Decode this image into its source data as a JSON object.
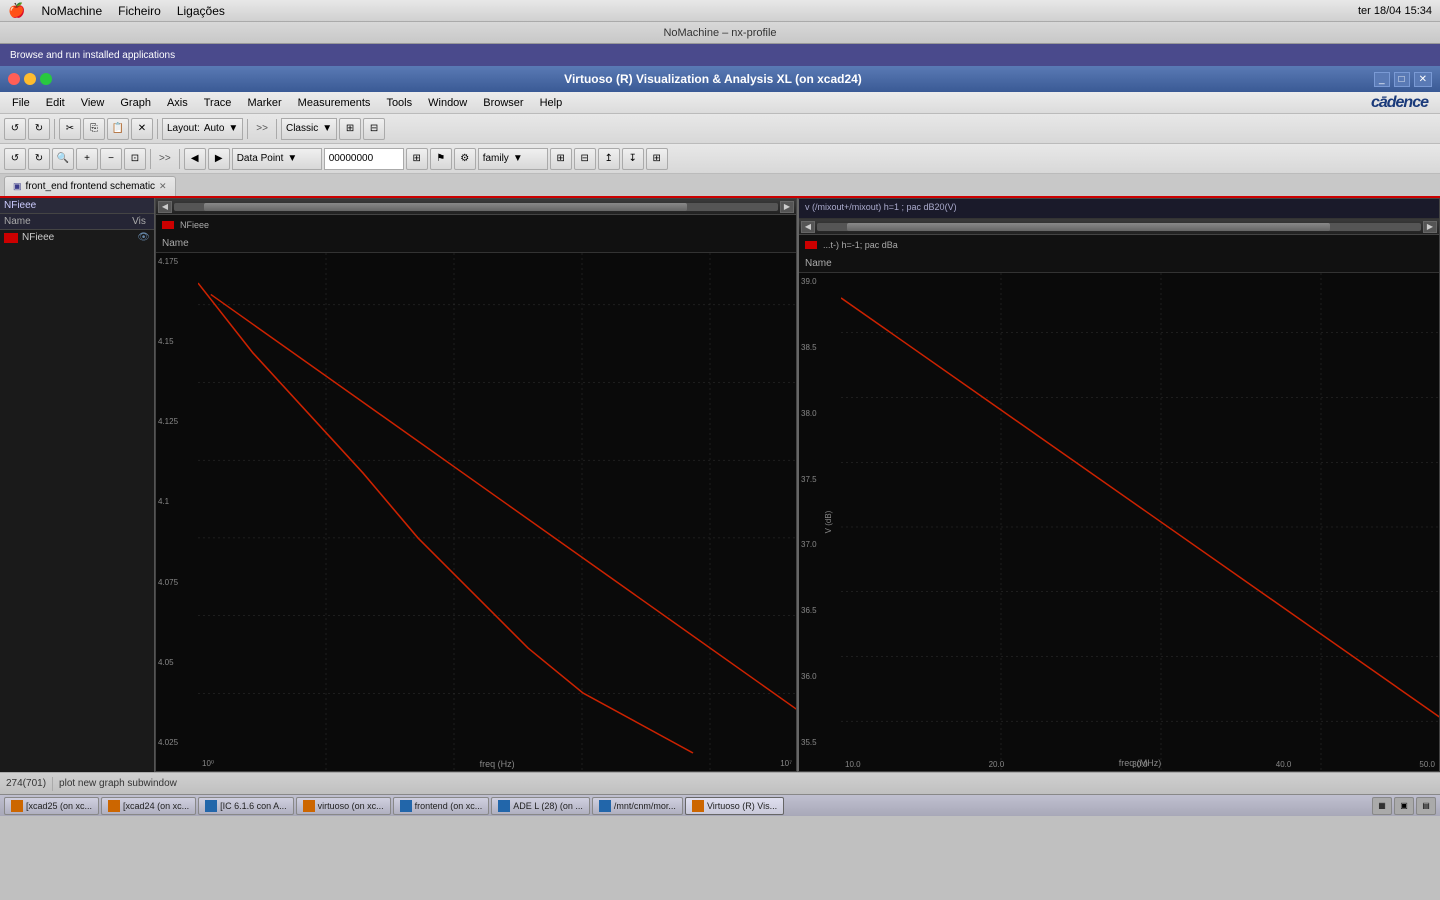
{
  "mac": {
    "apple": "🍎",
    "menus": [
      "NoMachine",
      "Ficheiro",
      "Ligações"
    ],
    "right_items": [
      "3:34 PM"
    ],
    "title": "NoMachine – nx-profile"
  },
  "browse_bar": {
    "text": "Browse and run installed applications"
  },
  "virt_title": "Virtuoso (R) Visualization & Analysis XL (on xcad24)",
  "menu_bar": {
    "items": [
      "File",
      "Edit",
      "View",
      "Graph",
      "Axis",
      "Trace",
      "Marker",
      "Measurements",
      "Tools",
      "Window",
      "Browser",
      "Help"
    ],
    "cadence": "cādence"
  },
  "toolbar1": {
    "layout_label": "Layout:",
    "layout_value": "Auto",
    "classic_value": "Classic",
    "expand": ">>"
  },
  "toolbar2": {
    "data_point": "Data Point",
    "value": "00000000",
    "family": "family",
    "expand": ">>"
  },
  "tab": {
    "label": "front_end frontend schematic",
    "close": "✕",
    "icon": "▣"
  },
  "graph1": {
    "header": "",
    "legend_label": "Name",
    "legend_item": "NFieee",
    "scrollbar_thumb_left": "5%",
    "scrollbar_thumb_width": "80%",
    "trace_label": "NFieee",
    "y_values": [
      "4.175",
      "4.15",
      "4.125",
      "4.1",
      "4.075",
      "4.05",
      "4.025"
    ],
    "x_label": "freq (Hz)",
    "x_min": "10⁰",
    "x_max": "10⁷",
    "panel_title": "NFieee"
  },
  "graph2": {
    "header": "v (/mixout+/mixout) h=1 ; pac dB20(V)",
    "legend_label": "Name",
    "legend_item": "...t-) h=-1; pac dBa",
    "scrollbar_thumb_left": "5%",
    "scrollbar_thumb_width": "80%",
    "trace_label": "...t-) h=-1; pac dBa",
    "y_values": [
      "39.0",
      "38.5",
      "38.0",
      "37.5",
      "37.0",
      "36.5",
      "36.0",
      "35.5"
    ],
    "x_label": "freq (MHz)",
    "x_min": "10.0",
    "x_max": "50.0",
    "y_axis_label": "V (dB)"
  },
  "status": {
    "left": "274(701)",
    "right": "plot new graph subwindow"
  },
  "taskbar": {
    "items": [
      {
        "label": "[xcad25 (on xc...",
        "type": "orange"
      },
      {
        "label": "[xcad24 (on xc...",
        "type": "orange"
      },
      {
        "label": "[IC 6.1.6 con A...",
        "type": "blue"
      },
      {
        "label": "virtuoso (on xc...",
        "type": "orange"
      },
      {
        "label": "frontend (on xc...",
        "type": "blue"
      },
      {
        "label": "ADE L (28) (on ...",
        "type": "blue"
      },
      {
        "label": "/mnt/cnm/mor...",
        "type": "blue"
      },
      {
        "label": "Virtuoso (R) Vis...",
        "type": "orange"
      }
    ]
  }
}
